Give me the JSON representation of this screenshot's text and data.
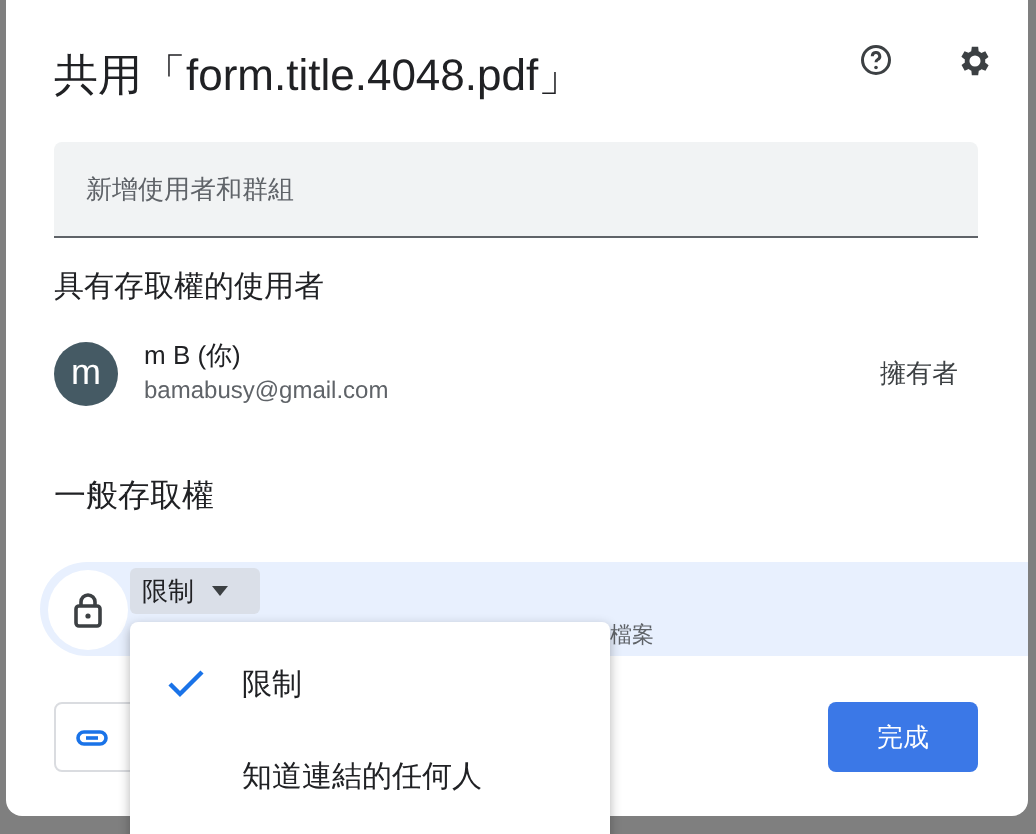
{
  "dialog": {
    "title": "共用「form.title.4048.pdf」"
  },
  "add_people": {
    "placeholder": "新增使用者和群組"
  },
  "people_heading": "具有存取權的使用者",
  "people": [
    {
      "initial": "m",
      "name": "m B (你)",
      "email": "bamabusy@gmail.com",
      "role": "擁有者"
    }
  ],
  "general_access": {
    "heading": "一般存取權",
    "dropdown": "限制",
    "description": "檔案"
  },
  "menu": [
    {
      "label": "限制",
      "selected": true
    },
    {
      "label": "知道連結的任何人",
      "selected": false
    }
  ],
  "done_button": "完成"
}
